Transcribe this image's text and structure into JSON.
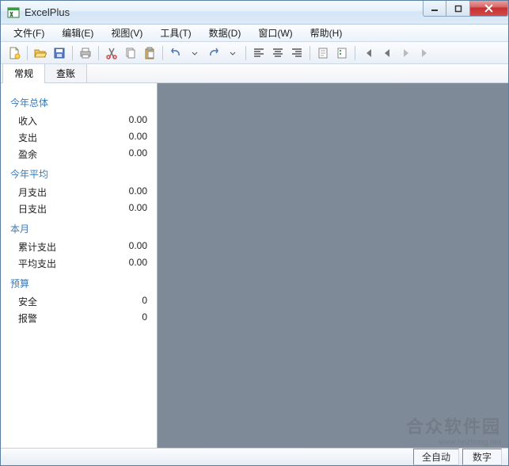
{
  "window": {
    "title": "ExcelPlus"
  },
  "menus": {
    "file": "文件(F)",
    "edit": "编辑(E)",
    "view": "视图(V)",
    "tools": "工具(T)",
    "data": "数据(D)",
    "window": "窗口(W)",
    "help": "帮助(H)"
  },
  "tabs": {
    "tab1": "常规",
    "tab2": "查账"
  },
  "panel": {
    "section1": {
      "title": "今年总体",
      "r1_label": "收入",
      "r1_val": "0.00",
      "r2_label": "支出",
      "r2_val": "0.00",
      "r3_label": "盈余",
      "r3_val": "0.00"
    },
    "section2": {
      "title": "今年平均",
      "r1_label": "月支出",
      "r1_val": "0.00",
      "r2_label": "日支出",
      "r2_val": "0.00"
    },
    "section3": {
      "title": "本月",
      "r1_label": "累计支出",
      "r1_val": "0.00",
      "r2_label": "平均支出",
      "r2_val": "0.00"
    },
    "section4": {
      "title": "预算",
      "r1_label": "安全",
      "r1_val": "0",
      "r2_label": "报警",
      "r2_val": "0"
    }
  },
  "status": {
    "cell1": "全自动",
    "cell2": "数字"
  },
  "watermark": {
    "big": "合众软件园",
    "small": "www.hezhong.net"
  }
}
